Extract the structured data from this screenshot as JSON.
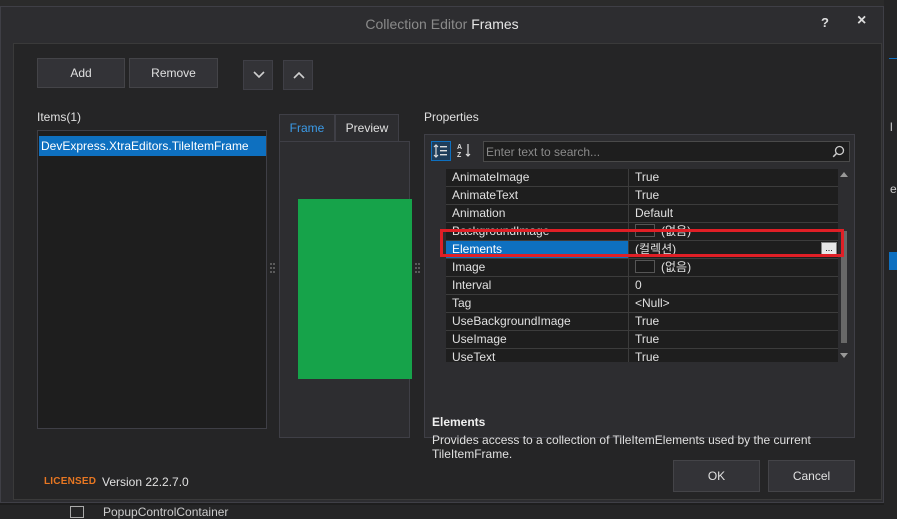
{
  "window": {
    "title_prefix": "Collection Editor",
    "title_main": "Frames",
    "help_label": "?",
    "close_label": "×"
  },
  "toolbar": {
    "add_label": "Add",
    "remove_label": "Remove",
    "move_down_icon": "chevron-down-icon",
    "move_up_icon": "chevron-up-icon"
  },
  "items": {
    "header": "Items(1)",
    "list": [
      "DevExpress.XtraEditors.TileItemFrame"
    ]
  },
  "preview": {
    "tabs": [
      "Frame",
      "Preview"
    ],
    "active_tab": "Frame",
    "tile_color": "#16a34a"
  },
  "properties": {
    "header": "Properties",
    "search_placeholder": "Enter text to search...",
    "rows": [
      {
        "name": "AnimateImage",
        "value": "True"
      },
      {
        "name": "AnimateText",
        "value": "True"
      },
      {
        "name": "Animation",
        "value": "Default"
      },
      {
        "name": "BackgroundImage",
        "value": "(없음)"
      },
      {
        "name": "Elements",
        "value": "(컬렉션)"
      },
      {
        "name": "Image",
        "value": "(없음)"
      },
      {
        "name": "Interval",
        "value": "0"
      },
      {
        "name": "Tag",
        "value": "<Null>"
      },
      {
        "name": "UseBackgroundImage",
        "value": "True"
      },
      {
        "name": "UseImage",
        "value": "True"
      },
      {
        "name": "UseText",
        "value": "True"
      }
    ],
    "selected": "Elements",
    "ellipsis_label": "...",
    "description_title": "Elements",
    "description_text": "Provides access to a collection of TileItemElements used by the current TileItemFrame."
  },
  "footer": {
    "licensed": "LICENSED",
    "version": "Version 22.2.7.0",
    "ok_label": "OK",
    "cancel_label": "Cancel"
  },
  "background": {
    "right_letters": [
      "l",
      "e"
    ],
    "bottom_text": "PopupControlContainer"
  },
  "colors": {
    "accent": "#0e70c0",
    "highlight_border": "#e01f26",
    "license": "#e87722"
  }
}
